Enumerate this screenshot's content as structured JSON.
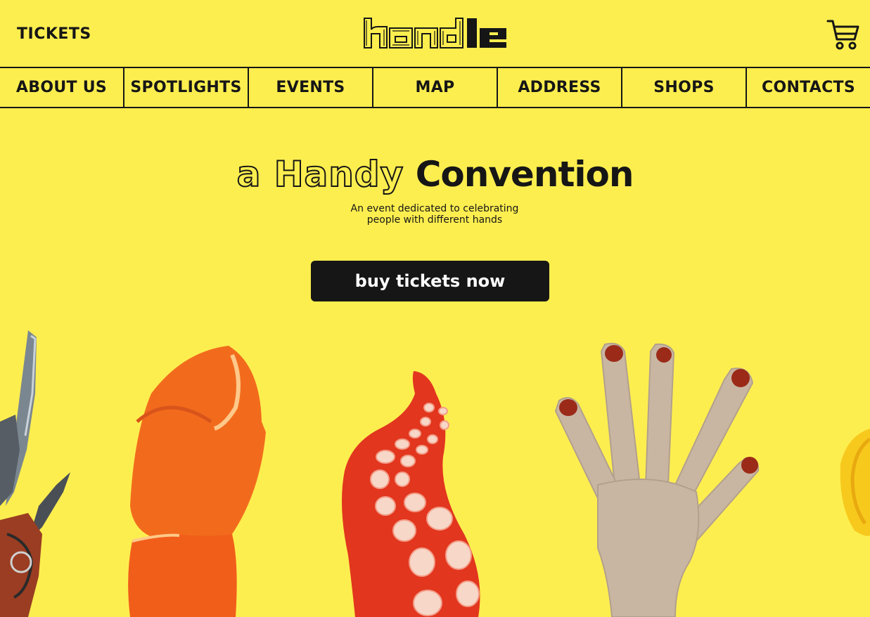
{
  "header": {
    "tickets_label": "TICKETS",
    "logo_text": "handle",
    "cart_icon": "shopping-cart-icon"
  },
  "nav": {
    "items": [
      {
        "label": "ABOUT US"
      },
      {
        "label": "SPOTLIGHTS"
      },
      {
        "label": "EVENTS"
      },
      {
        "label": "MAP"
      },
      {
        "label": "ADDRESS"
      },
      {
        "label": "SHOPS"
      },
      {
        "label": "CONTACTS"
      }
    ]
  },
  "hero": {
    "title_outline": "a Handy",
    "title_solid": "Convention",
    "subtitle_line1": "An event dedicated to celebrating",
    "subtitle_line2": "people with different hands",
    "cta_label": "buy tickets now"
  },
  "colors": {
    "background": "#FDEE4F",
    "ink": "#161616",
    "button_bg": "#161616",
    "button_text": "#FFFFFF"
  },
  "illustrations": [
    "pliers-hand",
    "lobster-claw",
    "octopus-tentacle",
    "painted-hand",
    "yellow-object"
  ]
}
